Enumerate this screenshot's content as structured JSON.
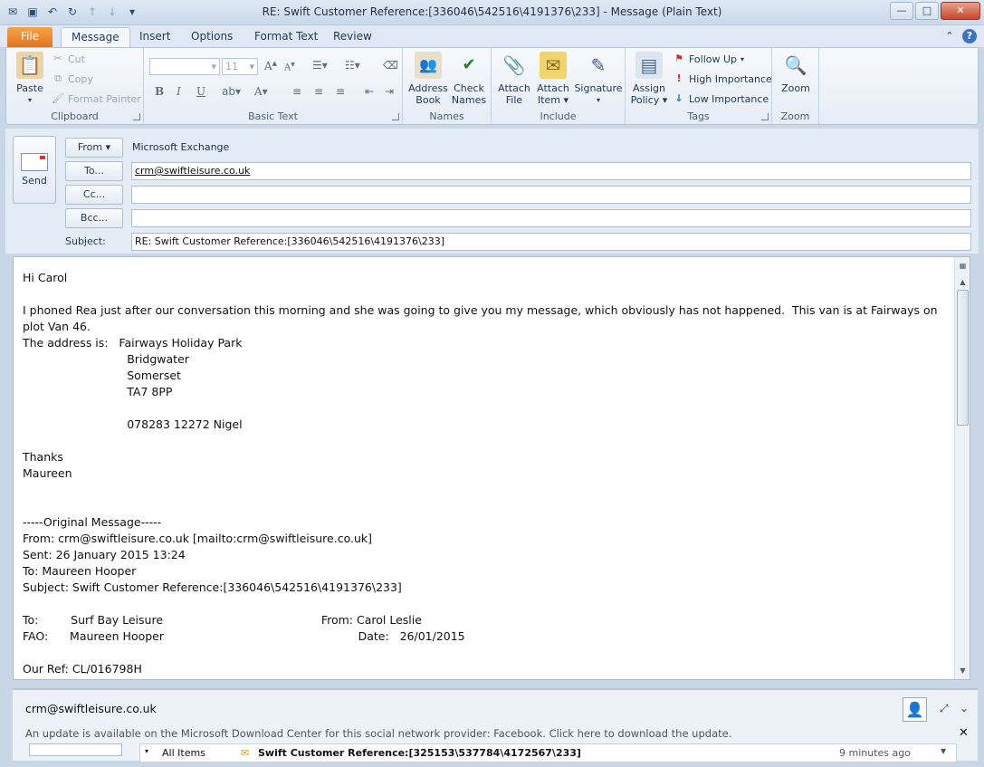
{
  "window": {
    "title": "RE: Swift Customer Reference:[336046\\542516\\4191376\\233]  -  Message (Plain Text)"
  },
  "qat": {
    "icons": [
      "outlook-icon",
      "save-icon",
      "undo-icon",
      "redo-icon",
      "previous-icon",
      "next-icon",
      "customize-icon"
    ]
  },
  "ribbon_tabs": [
    "File",
    "Message",
    "Insert",
    "Options",
    "Format Text",
    "Review"
  ],
  "ribbon": {
    "clipboard": {
      "label": "Clipboard",
      "paste": "Paste",
      "cut": "Cut",
      "copy": "Copy",
      "format_painter": "Format Painter"
    },
    "basic_text": {
      "label": "Basic Text",
      "font_size": "11"
    },
    "names": {
      "label": "Names",
      "address_book_1": "Address",
      "address_book_2": "Book",
      "check_names_1": "Check",
      "check_names_2": "Names"
    },
    "include": {
      "label": "Include",
      "attach_file_1": "Attach",
      "attach_file_2": "File",
      "attach_item_1": "Attach",
      "attach_item_2": "Item",
      "signature": "Signature"
    },
    "tags": {
      "label": "Tags",
      "assign_policy_1": "Assign",
      "assign_policy_2": "Policy",
      "follow_up": "Follow Up",
      "high_importance": "High Importance",
      "low_importance": "Low Importance"
    },
    "zoom": {
      "label": "Zoom",
      "zoom": "Zoom"
    }
  },
  "header": {
    "send": "Send",
    "from_button": "From",
    "from_account": "Microsoft Exchange",
    "to_button": "To...",
    "to_value": "crm@swiftleisure.co.uk",
    "cc_button": "Cc...",
    "cc_value": "",
    "bcc_button": "Bcc...",
    "bcc_value": "",
    "subject_label": "Subject:",
    "subject_value": "RE: Swift Customer Reference:[336046\\542516\\4191376\\233]"
  },
  "body": {
    "text": "Hi Carol\n\nI phoned Rea just after our conversation this morning and she was going to give you my message, which obviously has not happened.  This van is at Fairways on plot Van 46.\nThe address is:   Fairways Holiday Park\n                             Bridgwater\n                             Somerset\n                             TA7 8PP\n\n                             078283 12272 Nigel\n\nThanks\nMaureen\n\n\n-----Original Message-----\nFrom: crm@swiftleisure.co.uk [mailto:crm@swiftleisure.co.uk]\nSent: 26 January 2015 13:24\nTo: Maureen Hooper\nSubject: Swift Customer Reference:[336046\\542516\\4191376\\233]\n\nTo:         Surf Bay Leisure                                            From: Carol Leslie\nFAO:      Maureen Hooper                                                      Date:   26/01/2015\n\nOur Ref: CL/016798H"
  },
  "people_pane": {
    "account": "crm@swiftleisure.co.uk",
    "notice": "An update is available on the Microsoft Download Center for this social network provider: Facebook. Click here to download the update.",
    "all_items": "All Items",
    "activity_subject": "Swift Customer Reference:[325153\\537784\\4172567\\233]",
    "activity_time": "9 minutes ago"
  }
}
